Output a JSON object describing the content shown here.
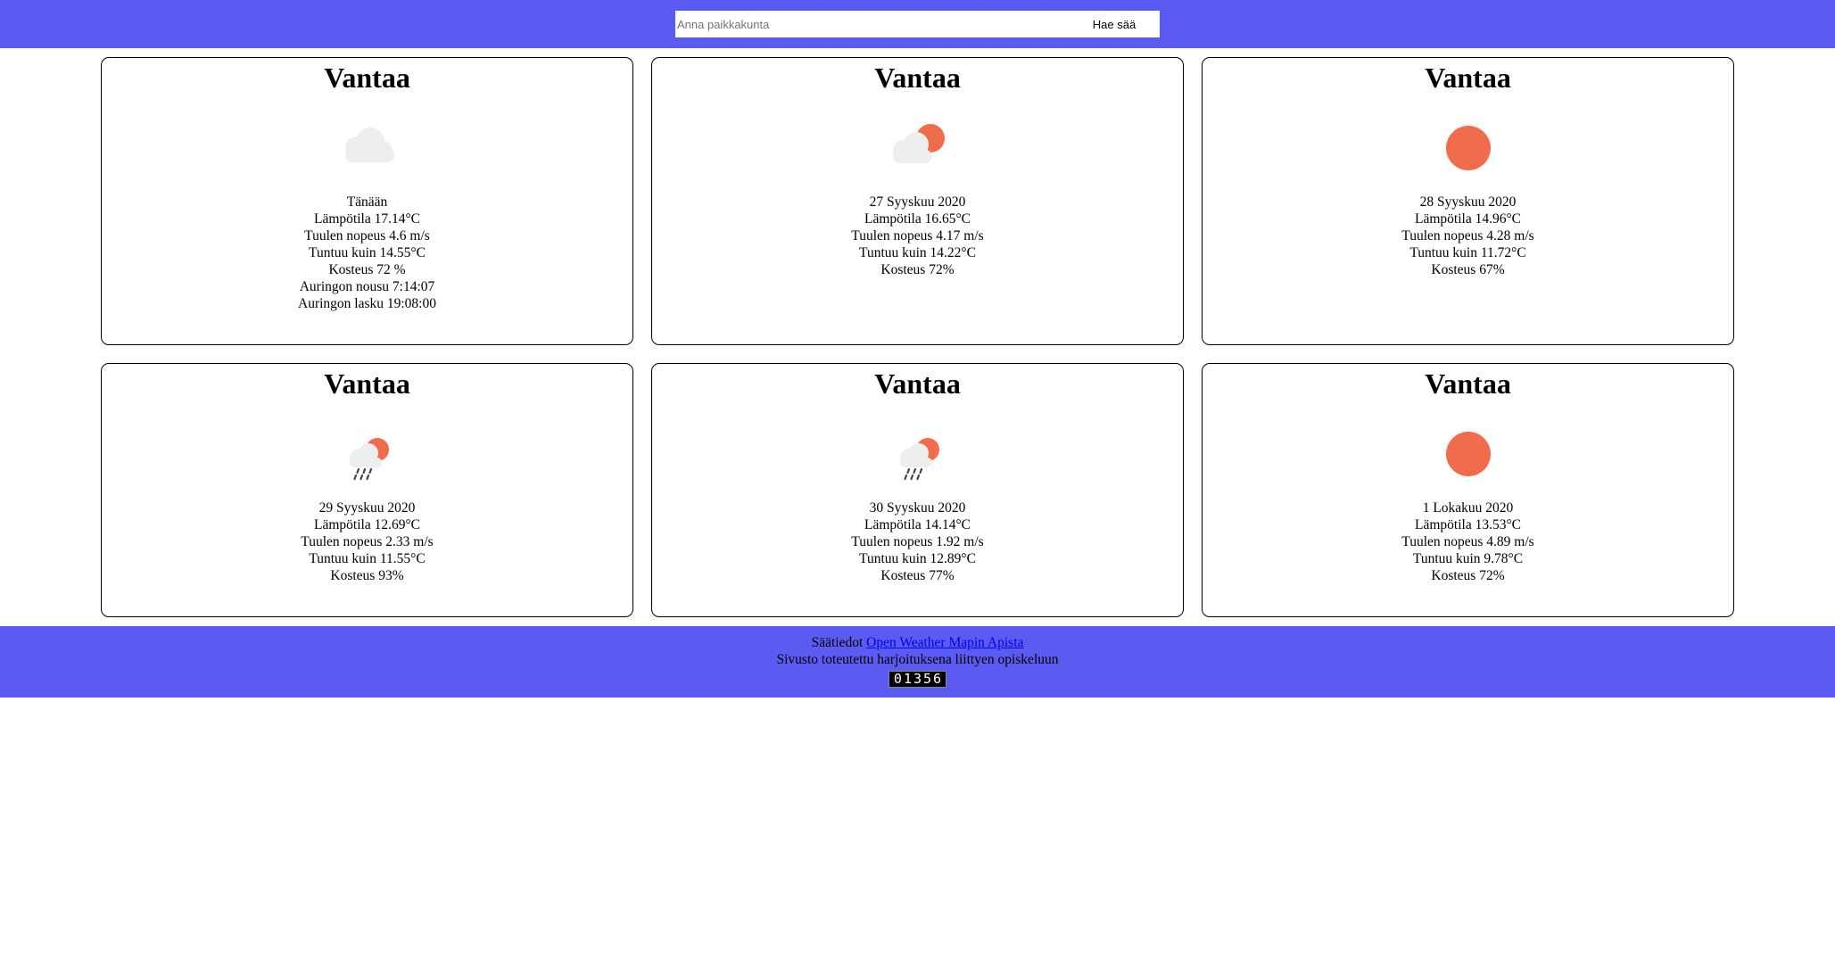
{
  "header": {
    "search_placeholder": "Anna paikkakunta",
    "search_button_label": "Hae sää"
  },
  "cards": [
    {
      "city": "Vantaa",
      "icon": "cloudy-icon",
      "lines": [
        "Tänään",
        "Lämpötila 17.14°C",
        "Tuulen nopeus 4.6 m/s",
        "Tuntuu kuin 14.55°C",
        "Kosteus 72 %",
        "Auringon nousu 7:14:07",
        "Auringon lasku 19:08:00"
      ]
    },
    {
      "city": "Vantaa",
      "icon": "partly-cloudy-icon",
      "lines": [
        "27 Syyskuu 2020",
        "Lämpötila 16.65°C",
        "Tuulen nopeus 4.17 m/s",
        "Tuntuu kuin 14.22°C",
        "Kosteus 72%"
      ]
    },
    {
      "city": "Vantaa",
      "icon": "sun-icon",
      "lines": [
        "28 Syyskuu 2020",
        "Lämpötila 14.96°C",
        "Tuulen nopeus 4.28 m/s",
        "Tuntuu kuin 11.72°C",
        "Kosteus 67%"
      ]
    },
    {
      "city": "Vantaa",
      "icon": "rain-sun-icon",
      "lines": [
        "29 Syyskuu 2020",
        "Lämpötila 12.69°C",
        "Tuulen nopeus 2.33 m/s",
        "Tuntuu kuin 11.55°C",
        "Kosteus 93%"
      ]
    },
    {
      "city": "Vantaa",
      "icon": "rain-sun-icon",
      "lines": [
        "30 Syyskuu 2020",
        "Lämpötila 14.14°C",
        "Tuulen nopeus 1.92 m/s",
        "Tuntuu kuin 12.89°C",
        "Kosteus 77%"
      ]
    },
    {
      "city": "Vantaa",
      "icon": "sun-icon",
      "lines": [
        "1 Lokakuu 2020",
        "Lämpötila 13.53°C",
        "Tuulen nopeus 4.89 m/s",
        "Tuntuu kuin 9.78°C",
        "Kosteus 72%"
      ]
    }
  ],
  "footer": {
    "source_prefix": "Säätiedot",
    "source_link_text": "Open Weather Mapin Apista",
    "note": "Sivusto toteutettu harjoituksena liittyen opiskeluun",
    "counter": "01356"
  },
  "colors": {
    "header_bg": "#5b5bf2",
    "sun": "#ef6c4d",
    "cloud": "#eeeeee"
  }
}
